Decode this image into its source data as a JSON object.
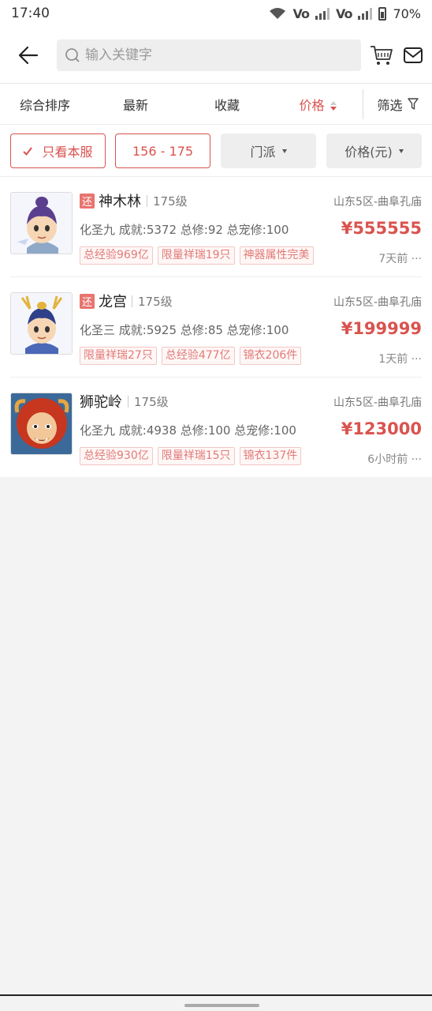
{
  "status_bar": {
    "time": "17:40",
    "battery": "70%",
    "vo1": "Vo",
    "vo2": "Vo"
  },
  "search": {
    "placeholder": "输入关键字"
  },
  "sort": {
    "items": [
      "综合排序",
      "最新",
      "收藏",
      "价格"
    ],
    "filter_label": "筛选",
    "active": "价格"
  },
  "filters": {
    "only_this_server": "只看本服",
    "level_range": "156 - 175",
    "sect": "门派",
    "price": "价格(元)"
  },
  "listings": [
    {
      "name": "神木林",
      "level": "175级",
      "server": "山东5区-曲阜孔庙",
      "stats": "化圣九 成就:5372 总修:92 总宠修:100",
      "price": "¥555555",
      "time": "7天前 ···",
      "returned": "还",
      "tags": [
        "总经验969亿",
        "限量祥瑞19只",
        "神器属性完美"
      ]
    },
    {
      "name": "龙宫",
      "level": "175级",
      "server": "山东5区-曲阜孔庙",
      "stats": "化圣三 成就:5925 总修:85 总宠修:100",
      "price": "¥199999",
      "time": "1天前 ···",
      "returned": "还",
      "tags": [
        "限量祥瑞27只",
        "总经验477亿",
        "锦衣206件"
      ]
    },
    {
      "name": "狮驼岭",
      "level": "175级",
      "server": "山东5区-曲阜孔庙",
      "stats": "化圣九 成就:4938 总修:100 总宠修:100",
      "price": "¥123000",
      "time": "6小时前 ···",
      "tags": [
        "总经验930亿",
        "限量祥瑞15只",
        "锦衣137件"
      ]
    }
  ],
  "colors": {
    "accent": "#d9534f",
    "tag_text": "#e07b78",
    "background": "#f3f3f3"
  }
}
